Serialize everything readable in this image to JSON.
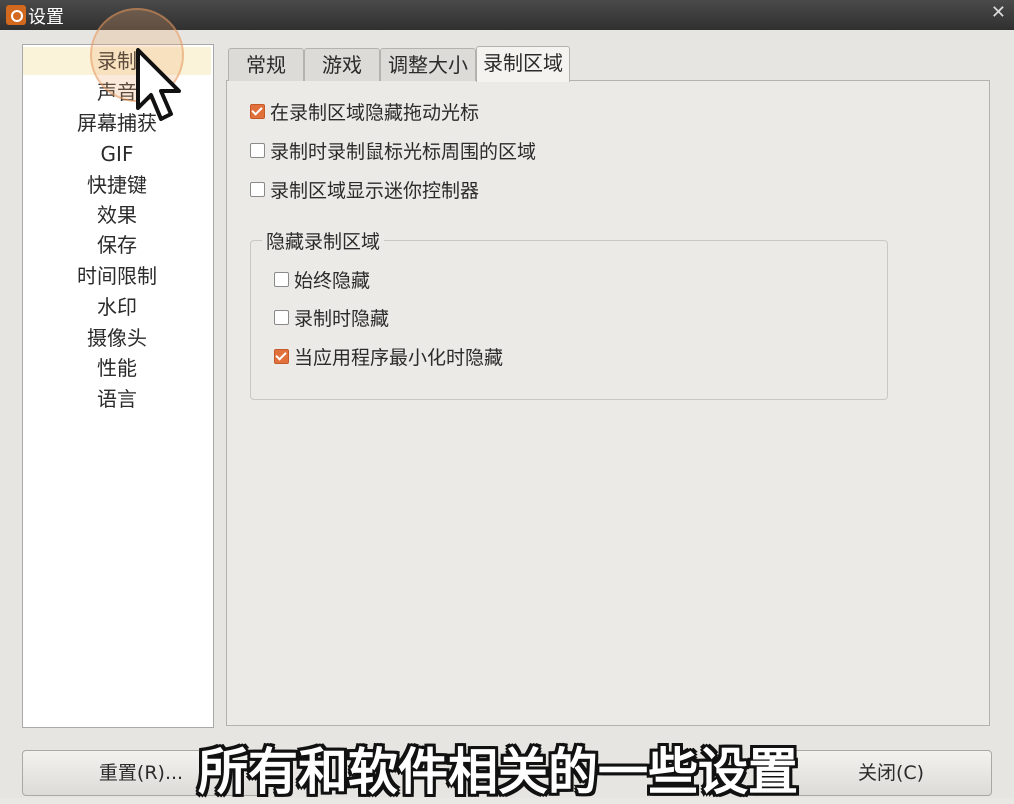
{
  "window": {
    "title": "设置",
    "close_icon": "close-icon"
  },
  "sidebar": {
    "items": [
      {
        "label": "录制",
        "selected": true
      },
      {
        "label": "声音"
      },
      {
        "label": "屏幕捕获"
      },
      {
        "label": "GIF"
      },
      {
        "label": "快捷键"
      },
      {
        "label": "效果"
      },
      {
        "label": "保存"
      },
      {
        "label": "时间限制"
      },
      {
        "label": "水印"
      },
      {
        "label": "摄像头"
      },
      {
        "label": "性能"
      },
      {
        "label": "语言"
      }
    ]
  },
  "tabs": [
    {
      "label": "常规"
    },
    {
      "label": "游戏"
    },
    {
      "label": "调整大小"
    },
    {
      "label": "录制区域",
      "active": true
    }
  ],
  "options": [
    {
      "label": "在录制区域隐藏拖动光标",
      "checked": true
    },
    {
      "label": "录制时录制鼠标光标周围的区域",
      "checked": false
    },
    {
      "label": "录制区域显示迷你控制器",
      "checked": false
    }
  ],
  "hide_group": {
    "title": "隐藏录制区域",
    "options": [
      {
        "label": "始终隐藏",
        "checked": false
      },
      {
        "label": "录制时隐藏",
        "checked": false
      },
      {
        "label": "当应用程序最小化时隐藏",
        "checked": true
      }
    ]
  },
  "buttons": {
    "reset": "重置(R)...",
    "close": "关闭(C)"
  },
  "caption": "所有和软件相关的一些设置",
  "colors": {
    "accent": "#e2703a",
    "selected_bg": "#faf3d9",
    "titlebar": "#3a3a3a"
  }
}
